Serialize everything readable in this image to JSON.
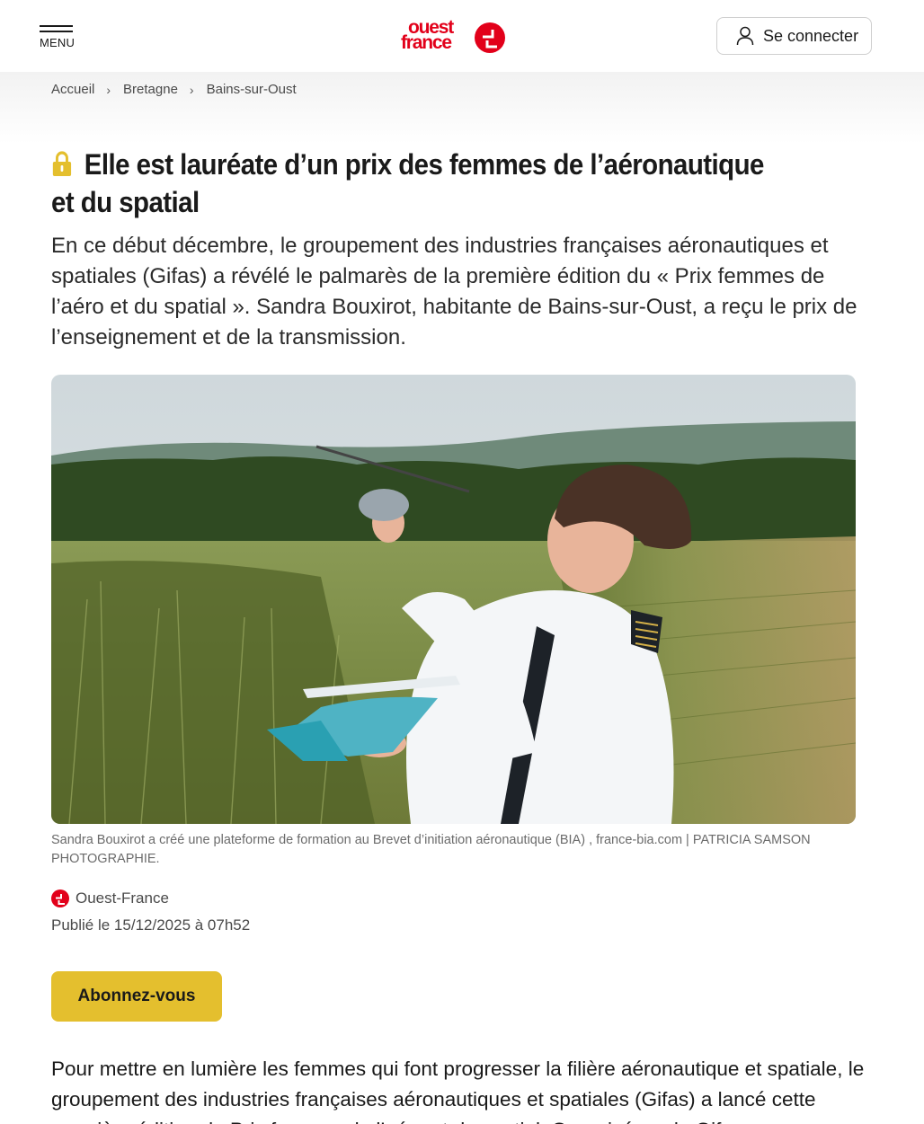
{
  "header": {
    "menu_label": "MENU",
    "logo_line1": "ouest",
    "logo_line2": "france",
    "connect_label": "Se connecter"
  },
  "breadcrumb": [
    "Accueil",
    "Bretagne",
    "Bains-sur-Oust"
  ],
  "article": {
    "title": "Elle est lauréate d’un prix des femmes de l’aéronautique et du spatial",
    "lede": "En ce début décembre, le groupement des industries françaises aéronautiques et spatiales (Gifas) a révélé le palmarès de la première édition du « Prix femmes de l’aéro et du spatial ». Sandra Bouxirot, habitante de Bains-sur-Oust, a reçu le prix de l’enseignement et de la transmission.",
    "caption": "Sandra Bouxirot a créé une plateforme de formation au Brevet d’initiation aéronautique (BIA) , france-bia.com | PATRICIA SAMSON PHOTOGRAPHIE.",
    "source": "Ouest-France",
    "published": "Publié le 15/12/2025 à 07h52",
    "subscribe_label": "Abonnez-vous",
    "body": "Pour mettre en lumière les femmes qui font progresser la filière aéronautique et spatiale, le groupement des industries françaises aéronautiques et spatiales (Gifas) a lancé cette première édition du Prix femmes de l’aéro et du spatial. Organisé par la Gifas, ce concours"
  },
  "colors": {
    "brand_red": "#e2001a",
    "subscribe_yellow": "#e4bf2e",
    "premium_lock": "#e4bf2e"
  },
  "icons": {
    "menu": "hamburger-icon",
    "user": "user-icon",
    "lock": "lock-icon",
    "chevron": "chevron-right-icon"
  }
}
